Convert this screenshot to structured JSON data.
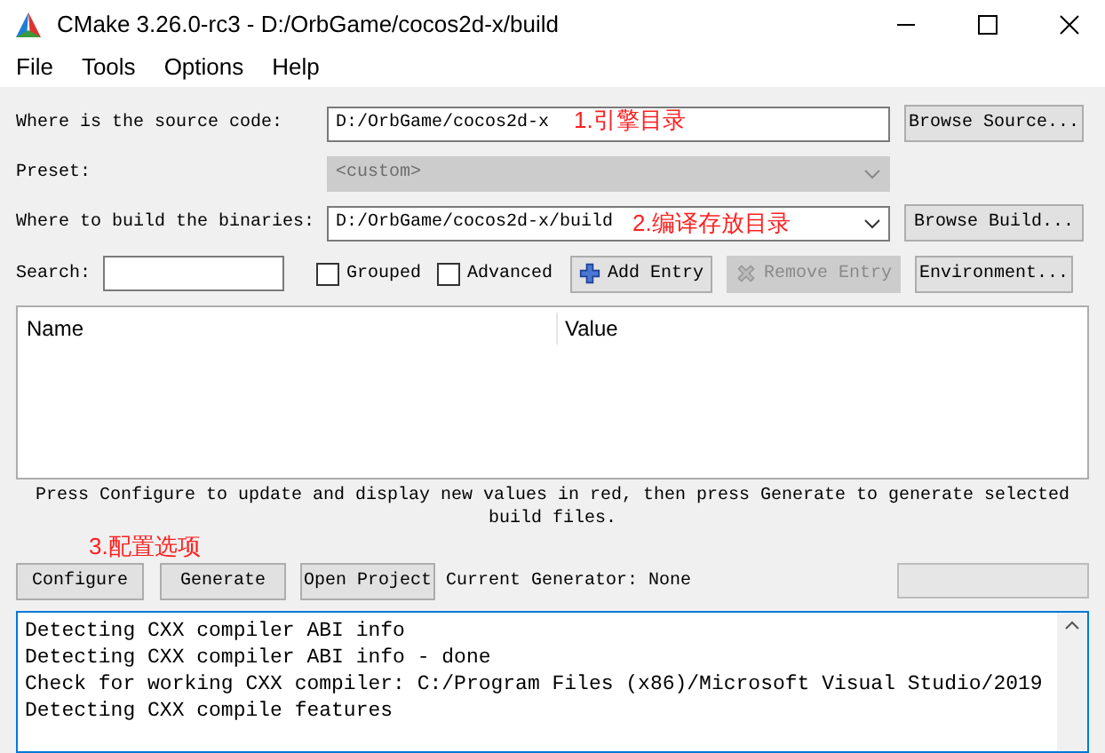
{
  "window": {
    "title": "CMake 3.26.0-rc3 - D:/OrbGame/cocos2d-x/build"
  },
  "menu": [
    "File",
    "Tools",
    "Options",
    "Help"
  ],
  "source": {
    "label": "Where is the source code:",
    "value": "D:/OrbGame/cocos2d-x",
    "button": "Browse Source..."
  },
  "preset": {
    "label": "Preset:",
    "value": "<custom>",
    "disabled": true
  },
  "build": {
    "label": "Where to build the binaries:",
    "value": "D:/OrbGame/cocos2d-x/build",
    "button": "Browse Build..."
  },
  "search": {
    "label": "Search:"
  },
  "options": [
    {
      "label": "Grouped",
      "checked": false
    },
    {
      "label": "Advanced",
      "checked": false
    }
  ],
  "entry_buttons": [
    {
      "label": "Add Entry",
      "kind": "add",
      "disabled": false
    },
    {
      "label": "Remove Entry",
      "kind": "remove",
      "disabled": true
    },
    {
      "label": "Environment...",
      "kind": "plain",
      "disabled": false
    }
  ],
  "table": {
    "columns": [
      "Name",
      "Value"
    ]
  },
  "message": "Press Configure to update and display new values in red, then press Generate to generate selected build files.",
  "actions": [
    "Configure",
    "Generate",
    "Open Project"
  ],
  "generator": "Current Generator: None",
  "log": [
    "Detecting CXX compiler ABI info",
    "Detecting CXX compiler ABI info - done",
    "Check for working CXX compiler: C:/Program Files (x86)/Microsoft Visual Studio/2019",
    "Detecting CXX compile features"
  ],
  "annotations": [
    "1.引擎目录",
    "2.编译存放目录",
    "3.配置选项"
  ]
}
